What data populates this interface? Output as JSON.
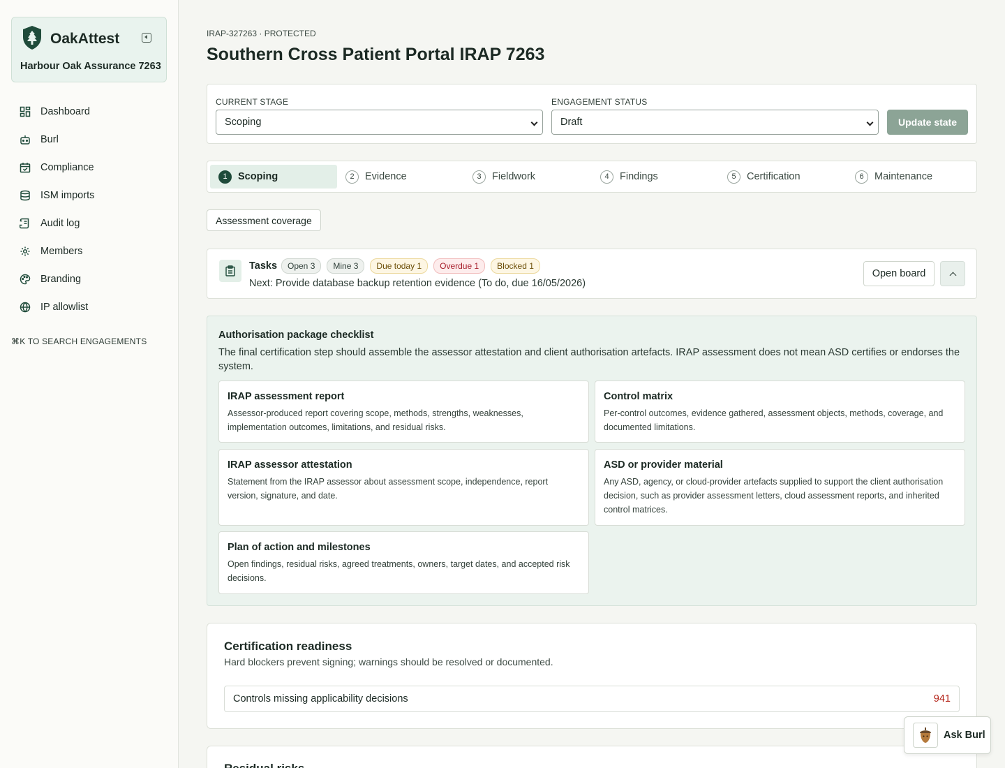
{
  "sidebar": {
    "brand": "OakAttest",
    "org_name": "Harbour Oak Assurance 7263",
    "items": [
      {
        "label": "Dashboard",
        "icon": "dashboard-icon"
      },
      {
        "label": "Burl",
        "icon": "bot-icon"
      },
      {
        "label": "Compliance",
        "icon": "calendar-check-icon"
      },
      {
        "label": "ISM imports",
        "icon": "database-icon"
      },
      {
        "label": "Audit log",
        "icon": "scroll-icon"
      },
      {
        "label": "Members",
        "icon": "gear-icon"
      },
      {
        "label": "Branding",
        "icon": "palette-icon"
      },
      {
        "label": "IP allowlist",
        "icon": "globe-icon"
      }
    ],
    "search_hint": "⌘K TO SEARCH ENGAGEMENTS"
  },
  "header": {
    "eyebrow": "IRAP-327263 · PROTECTED",
    "title": "Southern Cross Patient Portal IRAP 7263"
  },
  "state": {
    "stage_label": "CURRENT STAGE",
    "stage_value": "Scoping",
    "status_label": "ENGAGEMENT STATUS",
    "status_value": "Draft",
    "update_label": "Update state"
  },
  "stages": [
    {
      "num": "1",
      "label": "Scoping"
    },
    {
      "num": "2",
      "label": "Evidence"
    },
    {
      "num": "3",
      "label": "Fieldwork"
    },
    {
      "num": "4",
      "label": "Findings"
    },
    {
      "num": "5",
      "label": "Certification"
    },
    {
      "num": "6",
      "label": "Maintenance"
    }
  ],
  "coverage_label": "Assessment coverage",
  "tasks": {
    "title": "Tasks",
    "badges": [
      "Open 3",
      "Mine 3",
      "Due today 1",
      "Overdue 1",
      "Blocked 1"
    ],
    "next": "Next: Provide database backup retention evidence (To do, due 16/05/2026)",
    "open_board": "Open board"
  },
  "checklist": {
    "title": "Authorisation package checklist",
    "description": "The final certification step should assemble the assessor attestation and client authorisation artefacts. IRAP assessment does not mean ASD certifies or endorses the system.",
    "items": [
      {
        "title": "IRAP assessment report",
        "desc": "Assessor-produced report covering scope, methods, strengths, weaknesses, implementation outcomes, limitations, and residual risks."
      },
      {
        "title": "Control matrix",
        "desc": "Per-control outcomes, evidence gathered, assessment objects, methods, coverage, and documented limitations."
      },
      {
        "title": "IRAP assessor attestation",
        "desc": "Statement from the IRAP assessor about assessment scope, independence, report version, signature, and date."
      },
      {
        "title": "ASD or provider material",
        "desc": "Any ASD, agency, or cloud-provider artefacts supplied to support the client authorisation decision, such as provider assessment letters, cloud assessment reports, and inherited control matrices."
      },
      {
        "title": "Plan of action and milestones",
        "desc": "Open findings, residual risks, agreed treatments, owners, target dates, and accepted risk decisions."
      }
    ]
  },
  "readiness": {
    "title": "Certification readiness",
    "description": "Hard blockers prevent signing; warnings should be resolved or documented.",
    "row_label": "Controls missing applicability decisions",
    "row_count": "941"
  },
  "residual": {
    "title": "Residual risks"
  },
  "ask_label": "Ask Burl",
  "colors": {
    "accent": "#1f4b3a",
    "update_button": "#8ca496",
    "danger": "#b42318"
  }
}
